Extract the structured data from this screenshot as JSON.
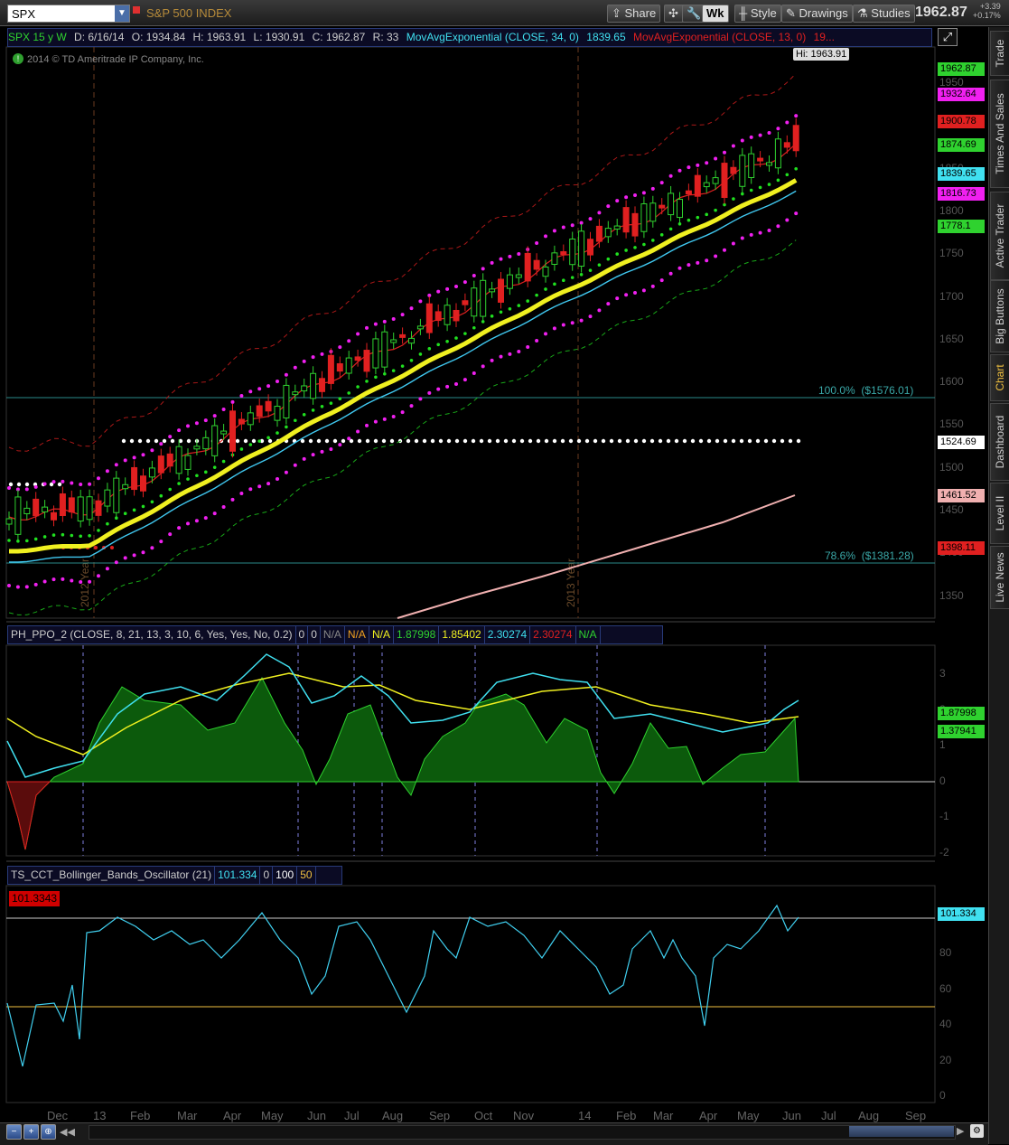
{
  "toolbar": {
    "symbol": "SPX",
    "symbol_name": "S&P 500 INDEX",
    "share": "Share",
    "wk": "Wk",
    "style": "Style",
    "drawings": "Drawings",
    "studies": "Studies",
    "last_price": "1962.87",
    "net_change": "+3.39",
    "pct_change": "+0.17%"
  },
  "right_tabs": [
    "Trade",
    "Times And Sales",
    "Active Trader",
    "Big Buttons",
    "Chart",
    "Dashboard",
    "Level II",
    "Live News"
  ],
  "price_header": {
    "symbol_period": "SPX 15 y W",
    "date": "D: 6/16/14",
    "open": "O: 1934.84",
    "high": "H: 1963.91",
    "low": "L: 1930.91",
    "close": "C: 1962.87",
    "range": "R: 33",
    "ema34_label": "MovAvgExponential (CLOSE, 34, 0)",
    "ema34_value": "1839.65",
    "ema13_label": "MovAvgExponential (CLOSE, 13, 0)",
    "ema13_value": "19..."
  },
  "copyright": "2014 © TD Ameritrade IP Company, Inc.",
  "hi_bubble": "Hi: 1963.91",
  "fib_levels": [
    {
      "label": "100.0%",
      "value": "($1576.01)"
    },
    {
      "label": "78.6%",
      "value": "($1381.28)"
    }
  ],
  "period_labels": [
    "2012 Year",
    "2013 Year"
  ],
  "price_axis_ticks": [
    "1950",
    "1900",
    "1850",
    "1800",
    "1750",
    "1700",
    "1650",
    "1600",
    "1550",
    "1500",
    "1450",
    "1400",
    "1350"
  ],
  "price_labels": [
    {
      "text": "1962.87",
      "color": "#2fd22f"
    },
    {
      "text": "1932.64",
      "color": "#f020f0"
    },
    {
      "text": "1900.78",
      "color": "#e02020"
    },
    {
      "text": "1874.69",
      "color": "#2fd22f"
    },
    {
      "text": "1839.65",
      "color": "#40e0f0"
    },
    {
      "text": "1816.73",
      "color": "#f020f0"
    },
    {
      "text": "1778.1",
      "color": "#2fd22f"
    },
    {
      "text": "1524.69",
      "color": "#ffffff"
    },
    {
      "text": "1461.52",
      "color": "#f0b0b0"
    },
    {
      "text": "1398.11",
      "color": "#e02020"
    }
  ],
  "ppo_header": {
    "name": "PH_PPO_2 (CLOSE, 8, 21, 13, 3, 10, 6, Yes, Yes, No, 0.2)",
    "cells": [
      {
        "text": "0",
        "color": "#cccccc"
      },
      {
        "text": "0",
        "color": "#cccccc"
      },
      {
        "text": "N/A",
        "color": "#888888"
      },
      {
        "text": "N/A",
        "color": "#f0a020"
      },
      {
        "text": "N/A",
        "color": "#f0f020"
      },
      {
        "text": "1.87998",
        "color": "#2fd22f"
      },
      {
        "text": "1.85402",
        "color": "#f0f020"
      },
      {
        "text": "2.30274",
        "color": "#40e0f0"
      },
      {
        "text": "2.30274",
        "color": "#e02020"
      },
      {
        "text": "N/A",
        "color": "#2fd22f"
      }
    ]
  },
  "ppo_axis_ticks": [
    "3",
    "2",
    "1",
    "0",
    "-1",
    "-2"
  ],
  "ppo_labels": [
    {
      "text": "1.87998",
      "color": "#2fd22f"
    },
    {
      "text": "1.37941",
      "color": "#2fd22f"
    }
  ],
  "bbo_header": {
    "name": "TS_CCT_Bollinger_Bands_Oscillator (21)",
    "cells": [
      {
        "text": "101.334",
        "color": "#40e0f0"
      },
      {
        "text": "0",
        "color": "#cccccc"
      },
      {
        "text": "100",
        "color": "#ffffff"
      },
      {
        "text": "50",
        "color": "#f0c040"
      }
    ]
  },
  "bbo_current": "101.3343",
  "bbo_label": "101.334",
  "bbo_axis_ticks": [
    "80",
    "60",
    "40",
    "20",
    "0"
  ],
  "x_axis": [
    "Dec",
    "13",
    "Feb",
    "Mar",
    "Apr",
    "May",
    "Jun",
    "Jul",
    "Aug",
    "Sep",
    "Oct",
    "Nov",
    "14",
    "Feb",
    "Mar",
    "Apr",
    "May",
    "Jun",
    "Jul",
    "Aug",
    "Sep"
  ]
}
